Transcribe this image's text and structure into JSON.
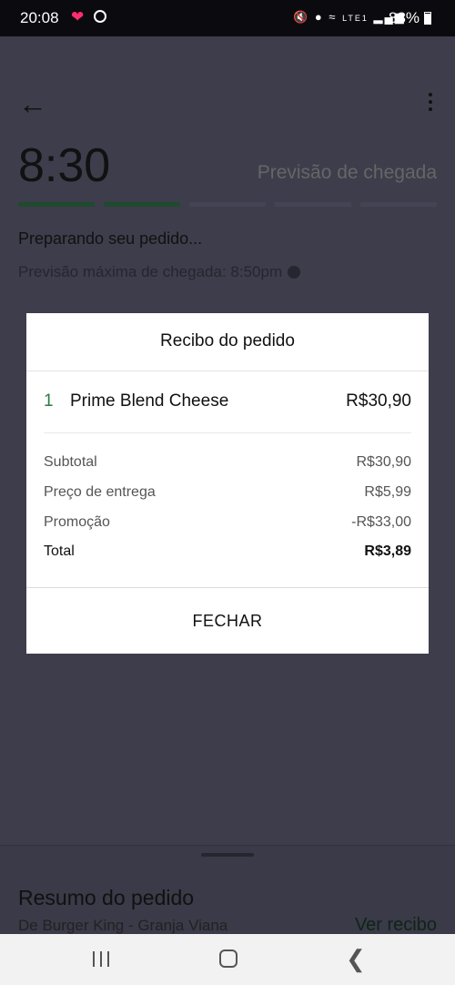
{
  "status_bar": {
    "time": "20:08",
    "battery_text": "88%",
    "network_label": "LTE1",
    "icons": [
      "heart-icon",
      "whatsapp-icon",
      "mute-icon",
      "location-icon",
      "wifi-icon",
      "signal-icon",
      "battery-icon"
    ]
  },
  "tracking": {
    "eta_time": "8:30",
    "eta_label": "Previsão de chegada",
    "status": "Preparando seu pedido...",
    "max_eta": "Previsão máxima de chegada: 8:50pm",
    "progress_steps_total": 5,
    "progress_steps_done": 2
  },
  "summary": {
    "title": "Resumo do pedido",
    "restaurant": "De Burger King - Granja Viana",
    "view_receipt": "Ver recibo"
  },
  "dialog": {
    "title": "Recibo do pedido",
    "items": [
      {
        "qty": "1",
        "name": "Prime Blend Cheese",
        "price": "R$30,90"
      }
    ],
    "rows": [
      {
        "label": "Subtotal",
        "value": "R$30,90"
      },
      {
        "label": "Preço de entrega",
        "value": "R$5,99"
      },
      {
        "label": "Promoção",
        "value": "-R$33,00"
      },
      {
        "label": "Total",
        "value": "R$3,89"
      }
    ],
    "close_label": "FECHAR"
  },
  "colors": {
    "overlay": "#3d3d4c",
    "accent_green": "#2d7a3e",
    "dialog_bg": "#ffffff"
  }
}
